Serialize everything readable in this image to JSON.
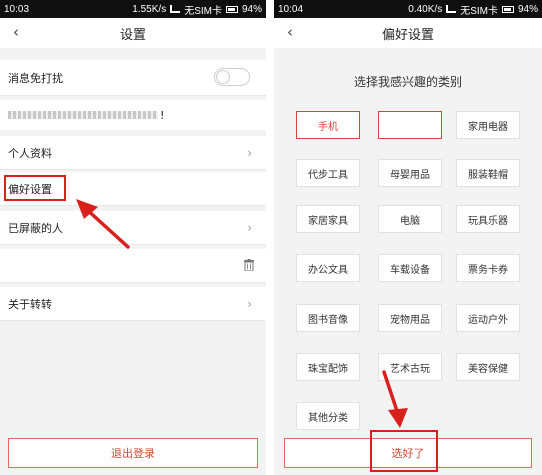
{
  "left": {
    "status": {
      "time": "10:03",
      "speed": "1.55K/s",
      "carrier": "无SIM卡",
      "battery": "94%"
    },
    "title": "设置",
    "dnd_label": "消息免打扰",
    "hidden_suffix": "!",
    "items": [
      {
        "label": "个人资料"
      },
      {
        "label": "偏好设置"
      },
      {
        "label": "已屏蔽的人"
      },
      {
        "label": "关于转转"
      }
    ],
    "logout_label": "退出登录"
  },
  "right": {
    "status": {
      "time": "10:04",
      "speed": "0.40K/s",
      "carrier": "无SIM卡",
      "battery": "94%"
    },
    "title": "偏好设置",
    "subtitle": "选择我感兴趣的类别",
    "categories": [
      {
        "label": "手机",
        "selected": true
      },
      {
        "label": "",
        "selected": true
      },
      {
        "label": "家用电器",
        "selected": false
      },
      {
        "label": "代步工具",
        "selected": false
      },
      {
        "label": "母婴用品",
        "selected": false
      },
      {
        "label": "服装鞋帽",
        "selected": false
      },
      {
        "label": "家居家具",
        "selected": false
      },
      {
        "label": "电脑",
        "selected": false
      },
      {
        "label": "玩具乐器",
        "selected": false
      },
      {
        "label": "办公文具",
        "selected": false
      },
      {
        "label": "车载设备",
        "selected": false
      },
      {
        "label": "票务卡券",
        "selected": false
      },
      {
        "label": "图书音像",
        "selected": false
      },
      {
        "label": "宠物用品",
        "selected": false
      },
      {
        "label": "运动户外",
        "selected": false
      },
      {
        "label": "珠宝配饰",
        "selected": false
      },
      {
        "label": "艺术古玩",
        "selected": false
      },
      {
        "label": "美容保健",
        "selected": false
      },
      {
        "label": "其他分类",
        "selected": false
      }
    ],
    "confirm_label": "选好了"
  },
  "colors": {
    "accent": "#d9443a",
    "annotation": "#d8201c"
  }
}
